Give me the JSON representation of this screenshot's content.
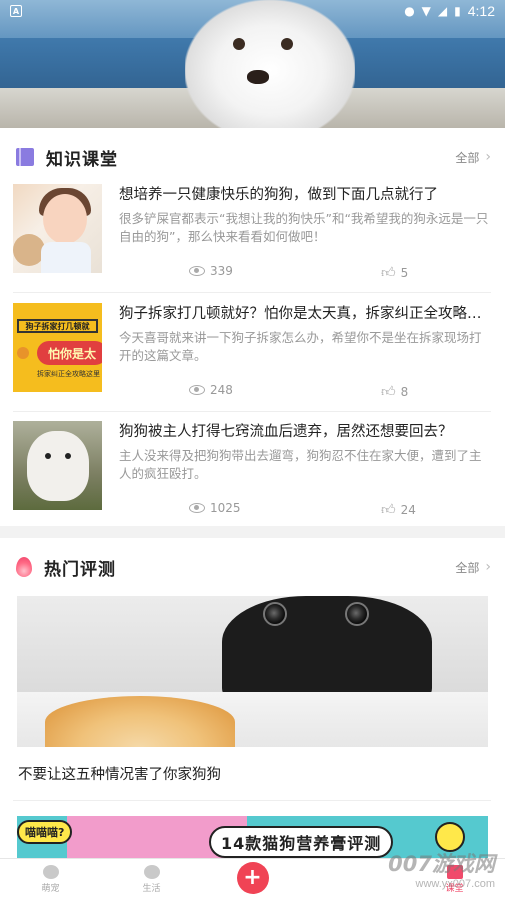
{
  "status_bar": {
    "left_icon_letter": "A",
    "time": "4:12"
  },
  "knowledge": {
    "title": "知识课堂",
    "more": "全部",
    "articles": [
      {
        "title": "想培养一只健康快乐的狗狗，做到下面几点就行了",
        "summary": "很多铲屎官都表示“我想让我的狗快乐”和“我希望我的狗永远是一只自由的狗”，那么快来看看如何做吧！",
        "views": "339",
        "likes": "5"
      },
      {
        "title": "狗子拆家打几顿就好？怕你是太天真，拆家纠正全攻略…",
        "summary": "今天喜哥就来讲一下狗子拆家怎么办，希望你不是坐在拆家现场打开的这篇文章。",
        "views": "248",
        "likes": "8",
        "thumb_band": "狗子拆家打几顿就",
        "thumb_bubble": "怕你是太",
        "thumb_foot": "拆家纠正全攻略这里"
      },
      {
        "title": "狗狗被主人打得七窍流血后遗弃，居然还想要回去？",
        "summary": "主人没来得及把狗狗带出去遛弯，狗狗忍不住在家大便，遭到了主人的疯狂殴打。",
        "views": "1025",
        "likes": "24"
      }
    ]
  },
  "hot_review": {
    "title": "热门评测",
    "more": "全部",
    "hero_caption": "不要让这五种情况害了你家狗狗",
    "promo_bubble": "喵喵喵?",
    "promo_headline": "14款猫狗营养膏评测"
  },
  "tabbar": {
    "tabs": [
      {
        "label": "萌宠"
      },
      {
        "label": "生活"
      },
      {
        "label": ""
      },
      {
        "label": ""
      },
      {
        "label": "课堂"
      }
    ],
    "plus_symbol": "+"
  },
  "watermark": {
    "line1": "007游戏网",
    "line2": "www.yx007.com"
  },
  "colors": {
    "accent": "#f04b6b",
    "knowledge_icon": "#8a7be0"
  }
}
